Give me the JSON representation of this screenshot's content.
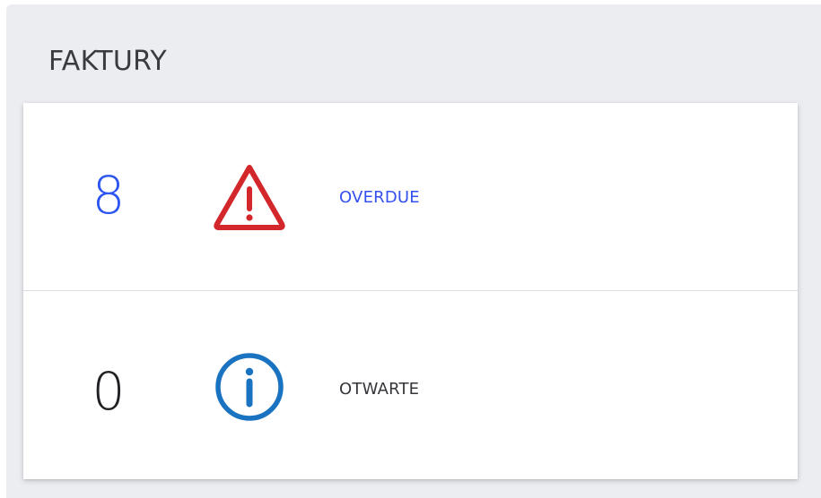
{
  "panel": {
    "title": "FAKTURY"
  },
  "rows": [
    {
      "count": "8",
      "label": "OVERDUE",
      "icon": "warning-triangle-icon",
      "count_color": "#2c55f2",
      "icon_color": "#d3272c"
    },
    {
      "count": "0",
      "label": "OTWARTE",
      "icon": "info-circle-icon",
      "count_color": "#1f2023",
      "icon_color": "#1a73c0"
    }
  ]
}
